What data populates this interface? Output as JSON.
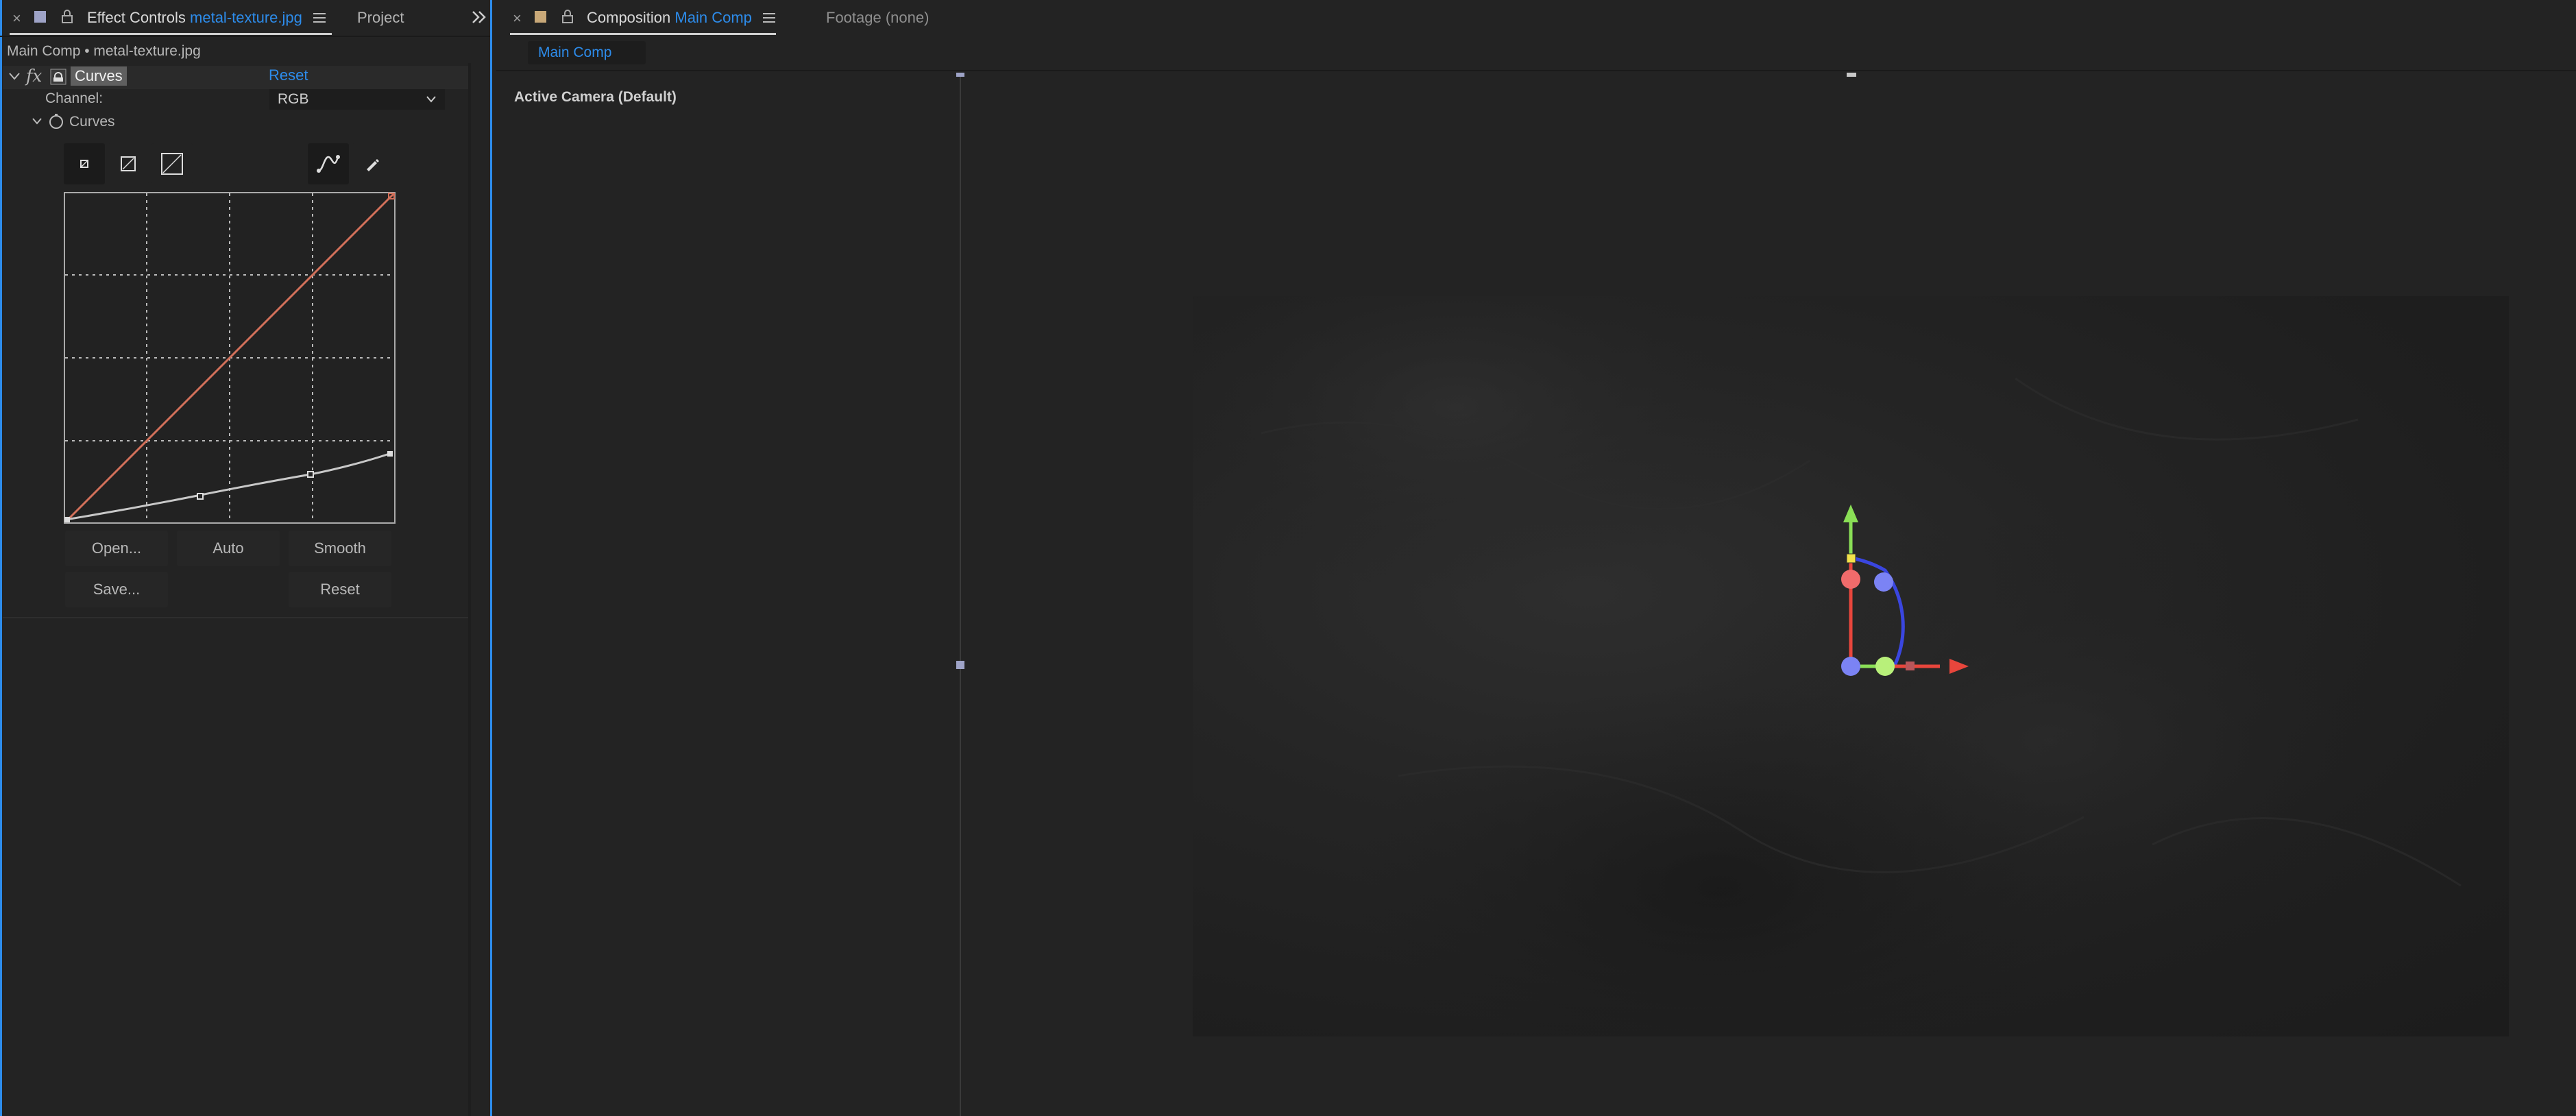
{
  "left_panel": {
    "tabs": {
      "effect_controls_label": "Effect Controls",
      "effect_controls_file": "metal-texture.jpg",
      "project_label": "Project"
    },
    "breadcrumb": "Main Comp • metal-texture.jpg",
    "effect": {
      "fx_label": "fx",
      "name": "Curves",
      "reset_label": "Reset",
      "channel_label": "Channel:",
      "channel_value": "RGB",
      "curves_prop_label": "Curves"
    },
    "buttons": {
      "open": "Open...",
      "auto": "Auto",
      "smooth": "Smooth",
      "save": "Save...",
      "reset": "Reset"
    },
    "colors": {
      "accent": "#2d8ceb",
      "rgb_diagonal": "#d2705a",
      "curve_line": "#c8c8c8"
    }
  },
  "right_panel": {
    "tabs": {
      "composition_label": "Composition",
      "composition_name": "Main Comp",
      "footage_label": "Footage (none)"
    },
    "comp_chip": "Main Comp",
    "camera_label": "Active Camera (Default)",
    "gizmo_colors": {
      "x_axis": "#e8463c",
      "y_axis": "#8adf56",
      "z_axis": "#3a46e0",
      "handle_red": "#f06b6b",
      "handle_green": "#b8f07a",
      "handle_blue": "#7b83f4"
    }
  }
}
